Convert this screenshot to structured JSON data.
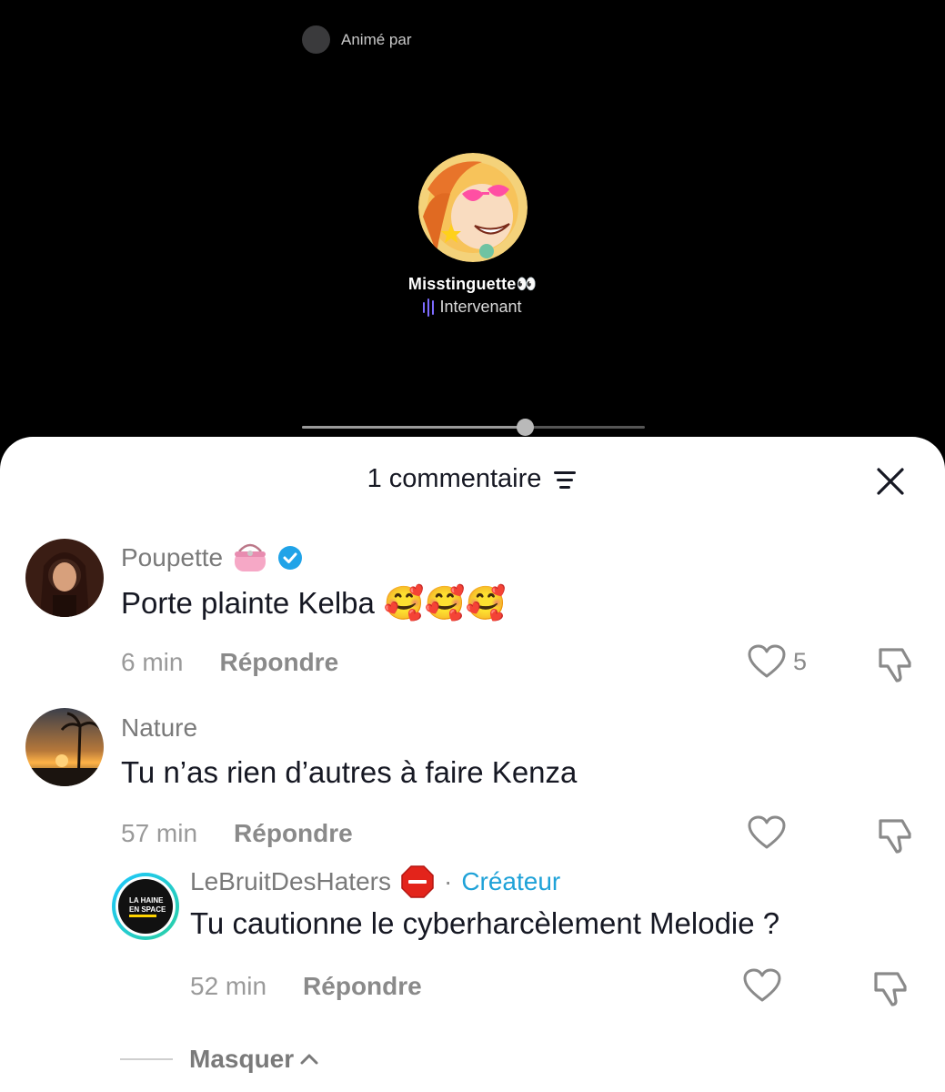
{
  "live": {
    "host_label": "Animé par",
    "speaker_name": "Misstinguette👀",
    "speaker_role": "Intervenant",
    "progress": 0.65
  },
  "sheet": {
    "title": "1 commentaire"
  },
  "comments": [
    {
      "author": "Poupette",
      "text": "Porte plainte Kelba",
      "emoji": "🥰🥰🥰",
      "time": "6 min",
      "reply": "Répondre",
      "likes": "5"
    },
    {
      "author": "Nature",
      "text": "Tu n’as rien d’autres à faire Kenza",
      "time": "57 min",
      "reply": "Répondre"
    }
  ],
  "reply": {
    "author": "LeBruitDesHaters",
    "separator": "·",
    "badge": "Créateur",
    "avatar_text_1": "LA HAINE",
    "avatar_text_2": "EN SPACE",
    "text": "Tu cautionne le cyberharcèlement Melodie ?",
    "time": "52 min",
    "reply": "Répondre"
  },
  "hide_label": "Masquer",
  "colors": {
    "creator": "#1fa2d8",
    "verified": "#20a3e8",
    "wave": "#7d6bff"
  }
}
